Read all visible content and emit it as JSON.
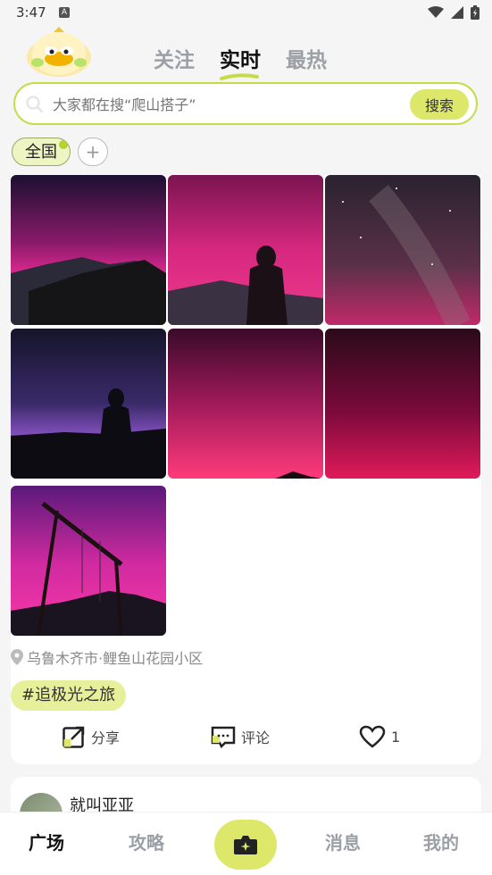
{
  "status": {
    "time": "3:47",
    "badge": "A"
  },
  "header": {
    "tabs": [
      {
        "label": "关注",
        "active": false
      },
      {
        "label": "实时",
        "active": true
      },
      {
        "label": "最热",
        "active": false
      }
    ]
  },
  "search": {
    "placeholder": "大家都在搜“爬山搭子”",
    "button": "搜索"
  },
  "region": {
    "selected": "全国",
    "add": "+"
  },
  "post": {
    "photos": [
      {
        "name": "aurora-mountain-house"
      },
      {
        "name": "aurora-silhouette-person"
      },
      {
        "name": "aurora-starry-sky"
      },
      {
        "name": "aurora-purple-person"
      },
      {
        "name": "aurora-pink-red"
      },
      {
        "name": "aurora-dark-red"
      },
      {
        "name": "aurora-swing"
      }
    ],
    "location": "乌鲁木齐市·鲤鱼山花园小区",
    "topic": "#追极光之旅",
    "actions": {
      "share": "分享",
      "comment": "评论",
      "likes": "1"
    }
  },
  "next_post": {
    "author": "就叫亚亚"
  },
  "bottom_nav": {
    "items": [
      {
        "label": "广场",
        "active": true
      },
      {
        "label": "攻略",
        "active": false
      },
      {
        "label": "消息",
        "active": false
      },
      {
        "label": "我的",
        "active": false
      }
    ]
  },
  "colors": {
    "accent": "#dde86a",
    "border": "#c7db4a"
  }
}
